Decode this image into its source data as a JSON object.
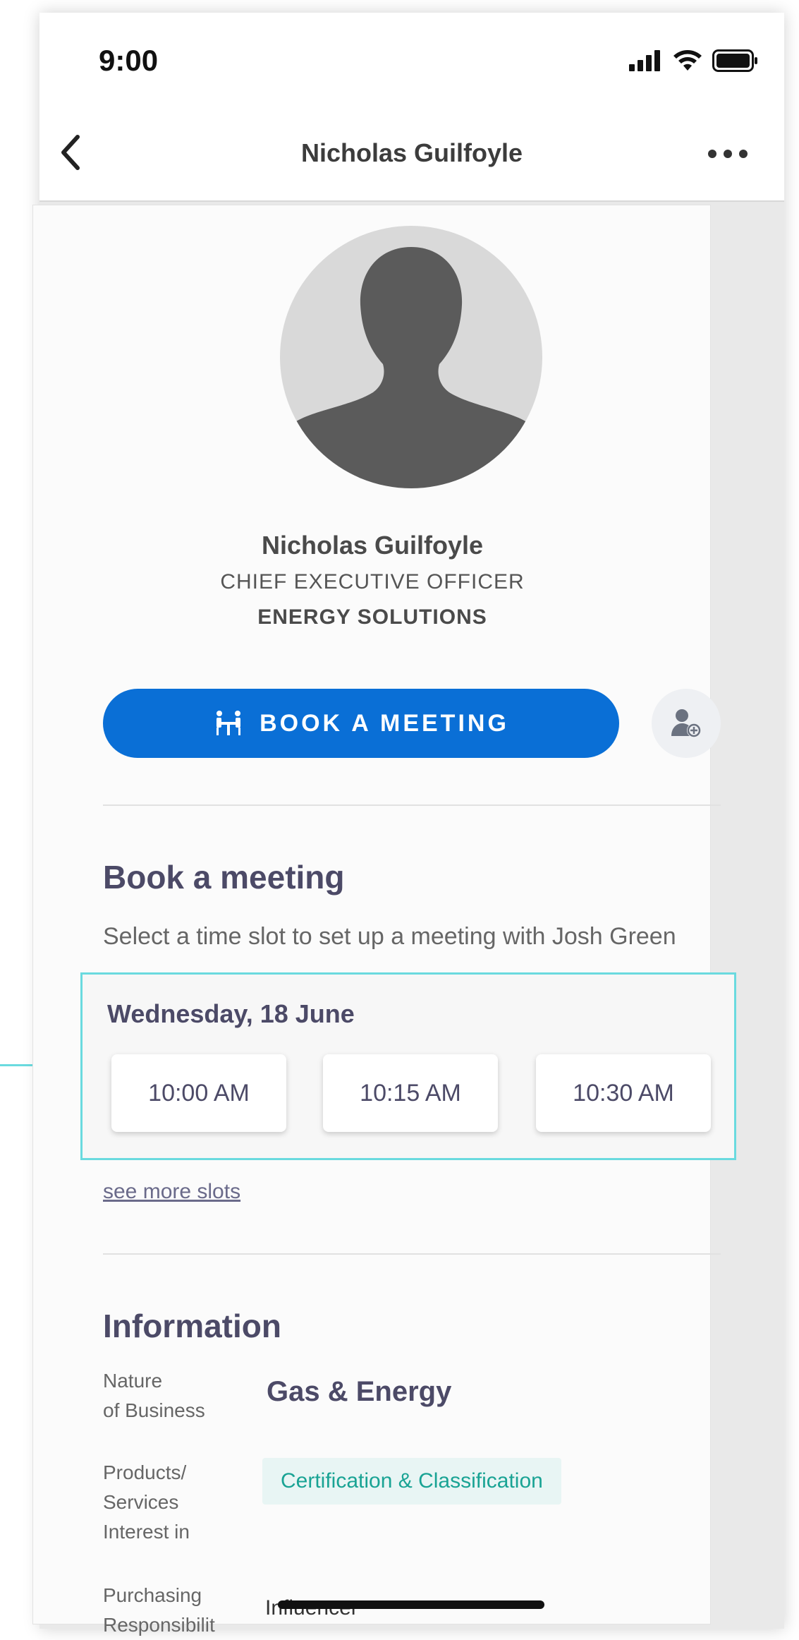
{
  "status_bar": {
    "time": "9:00"
  },
  "nav": {
    "title": "Nicholas Guilfoyle"
  },
  "profile": {
    "name": "Nicholas Guilfoyle",
    "title": "CHIEF EXECUTIVE OFFICER",
    "company": "ENERGY SOLUTIONS"
  },
  "actions": {
    "book_label": "BOOK A MEETING"
  },
  "booking": {
    "heading": "Book a meeting",
    "subtitle": "Select a time slot to set up a meeting with Josh Green",
    "date": "Wednesday, 18 June",
    "slots": [
      "10:00 AM",
      "10:15 AM",
      "10:30 AM"
    ],
    "see_more": "see more slots"
  },
  "information": {
    "heading": "Information",
    "rows": [
      {
        "label": "Nature\nof Business",
        "value": "Gas & Energy"
      },
      {
        "label": "Products/\nServices\nInterest in",
        "value": "Certification & Classification"
      },
      {
        "label": "Purchasing\nResponsibilit",
        "value": "Influencer"
      }
    ]
  },
  "colors": {
    "primary": "#0a6fd6",
    "heading": "#4c4a67",
    "highlight": "#6adadf",
    "tag_text": "#19a394",
    "tag_bg": "#e8f5f4"
  }
}
